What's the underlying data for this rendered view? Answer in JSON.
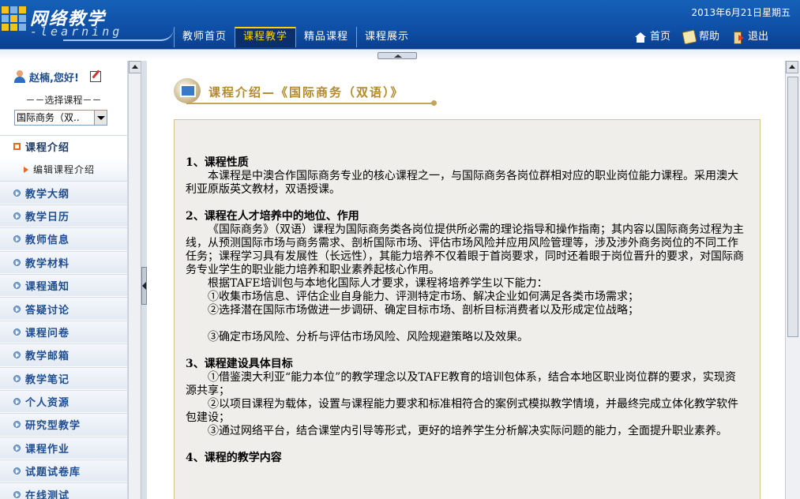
{
  "header": {
    "logo_title": "网络教学",
    "logo_subtitle": "-learning",
    "date": "2013年6月21日星期五",
    "nav_tabs": [
      {
        "label": "教师首页"
      },
      {
        "label": "课程教学"
      },
      {
        "label": "精品课程"
      },
      {
        "label": "课程展示"
      }
    ],
    "active_tab": "课程教学",
    "right_links": [
      {
        "label": "首页",
        "icon": "home-icon"
      },
      {
        "label": "帮助",
        "icon": "help-icon"
      },
      {
        "label": "退出",
        "icon": "exit-icon"
      }
    ]
  },
  "sidebar": {
    "user_greeting": "赵楠,您好!",
    "select_label": "－－选择课程－－",
    "selected_course": "国际商务（双..",
    "menu": [
      {
        "label": "课程介绍",
        "active": true
      },
      {
        "label": "编辑课程介绍",
        "sub": true
      },
      {
        "label": "教学大纲"
      },
      {
        "label": "教学日历"
      },
      {
        "label": "教师信息"
      },
      {
        "label": "教学材料"
      },
      {
        "label": "课程通知"
      },
      {
        "label": "答疑讨论"
      },
      {
        "label": "课程问卷"
      },
      {
        "label": "教学邮箱"
      },
      {
        "label": "教学笔记"
      },
      {
        "label": "个人资源"
      },
      {
        "label": "研究型教学"
      },
      {
        "label": "课程作业"
      },
      {
        "label": "试题试卷库"
      },
      {
        "label": "在线测试"
      }
    ]
  },
  "main": {
    "title": "课程介绍—《国际商务（双语）》",
    "lines": [
      {
        "type": "head",
        "text": "1、课程性质"
      },
      {
        "type": "para",
        "text": "本课程是中澳合作国际商务专业的核心课程之一，与国际商务各岗位群相对应的职业岗位能力课程。采用澳大利亚原版英文教材，双语授课。"
      },
      {
        "type": "gap",
        "text": ""
      },
      {
        "type": "head",
        "text": "2、课程在人才培养中的地位、作用"
      },
      {
        "type": "para",
        "text": "《国际商务》（双语）课程为国际商务类各岗位提供所必需的理论指导和操作指南；其内容以国际商务过程为主线，从预测国际市场与商务需求、剖析国际市场、评估市场风险并应用风险管理等，涉及涉外商务岗位的不同工作任务；课程学习具有发展性（长远性），其能力培养不仅着眼于首岗要求，同时还着眼于岗位晋升的要求，对国际商务专业学生的职业能力培养和职业素养起核心作用。"
      },
      {
        "type": "para",
        "text": "根据TAFE培训包与本地化国际人才要求，课程将培养学生以下能力："
      },
      {
        "type": "para",
        "text": "①收集市场信息、评估企业自身能力、评测特定市场、解决企业如何满足各类市场需求；"
      },
      {
        "type": "para",
        "text": "②选择潜在国际市场做进一步调研、确定目标市场、剖析目标消费者以及形成定位战略；"
      },
      {
        "type": "gap",
        "text": ""
      },
      {
        "type": "para",
        "text": "③确定市场风险、分析与评估市场风险、风险规避策略以及效果。"
      },
      {
        "type": "gap",
        "text": ""
      },
      {
        "type": "head",
        "text": "3、课程建设具体目标"
      },
      {
        "type": "para",
        "text": "①借鉴澳大利亚“能力本位”的教学理念以及TAFE教育的培训包体系，结合本地区职业岗位群的要求，实现资源共享；"
      },
      {
        "type": "para",
        "text": "②以项目课程为载体，设置与课程能力要求和标准相符合的案例式模拟教学情境，并最终完成立体化教学软件包建设；"
      },
      {
        "type": "para",
        "text": "③通过网络平台，结合课堂内引导等形式，更好的培养学生分析解决实际问题的能力，全面提升职业素养。"
      },
      {
        "type": "gap",
        "text": ""
      },
      {
        "type": "head",
        "text": "4、课程的教学内容"
      }
    ]
  }
}
